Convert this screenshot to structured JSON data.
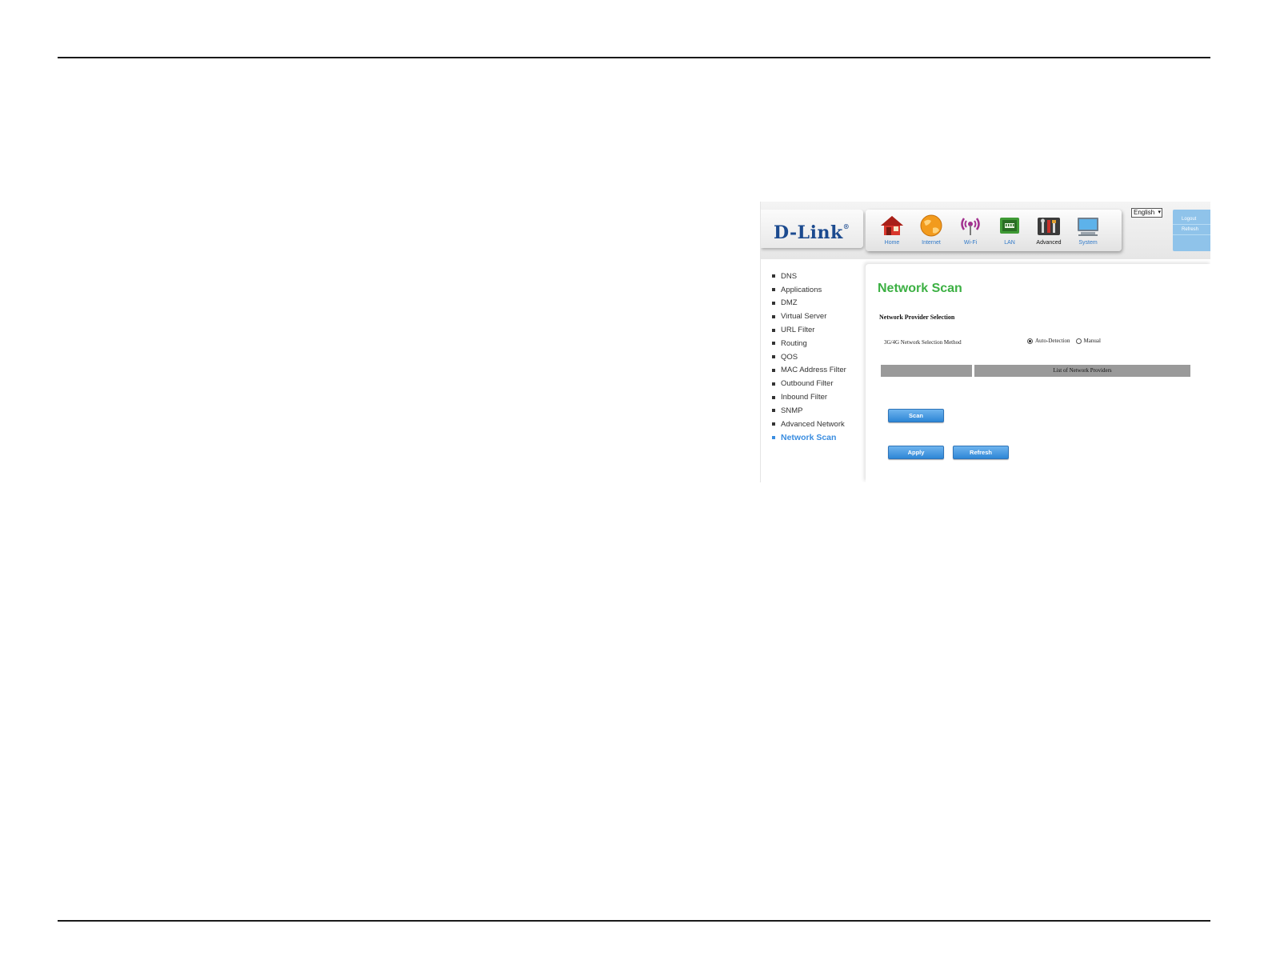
{
  "brand": {
    "logo_text": "D-Link",
    "logo_mark": "®",
    "color": "#1b4a8f"
  },
  "nav": {
    "items": [
      {
        "label": "Home",
        "icon": "home-icon",
        "active": false
      },
      {
        "label": "Internet",
        "icon": "globe-icon",
        "active": false
      },
      {
        "label": "Wi-Fi",
        "icon": "wifi-icon",
        "active": false
      },
      {
        "label": "LAN",
        "icon": "lan-icon",
        "active": false
      },
      {
        "label": "Advanced",
        "icon": "tools-icon",
        "active": true
      },
      {
        "label": "System",
        "icon": "monitor-icon",
        "active": false
      }
    ]
  },
  "language": {
    "selected": "English"
  },
  "account": {
    "logout_label": "Logout",
    "refresh_label": "Refresh"
  },
  "sidebar": {
    "items": [
      {
        "label": "DNS"
      },
      {
        "label": "Applications"
      },
      {
        "label": "DMZ"
      },
      {
        "label": "Virtual Server"
      },
      {
        "label": "URL Filter"
      },
      {
        "label": "Routing"
      },
      {
        "label": "QOS"
      },
      {
        "label": "MAC Address Filter"
      },
      {
        "label": "Outbound Filter"
      },
      {
        "label": "Inbound Filter"
      },
      {
        "label": "SNMP"
      },
      {
        "label": "Advanced Network"
      },
      {
        "label": "Network Scan",
        "active": true
      }
    ]
  },
  "main": {
    "title": "Network Scan",
    "section_title": "Network Provider Selection",
    "selection_method_label": "3G/4G Network Selection Method",
    "radio_options": [
      {
        "label": "Auto-Detection",
        "checked": true
      },
      {
        "label": "Manual",
        "checked": false
      }
    ],
    "table_headers": [
      "",
      "List of Network Providers"
    ],
    "scan_label": "Scan",
    "apply_label": "Apply",
    "refresh_label": "Refresh"
  },
  "colors": {
    "accent_green": "#3cb043",
    "link_blue": "#3a8de0",
    "button_blue": "#2e86d6"
  }
}
